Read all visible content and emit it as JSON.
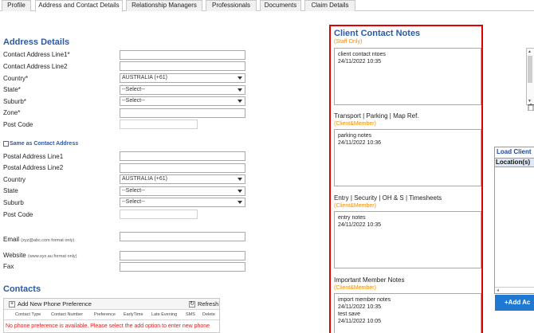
{
  "tabs": [
    {
      "label": "Profile"
    },
    {
      "label": "Address and Contact Details"
    },
    {
      "label": "Relationship Managers"
    },
    {
      "label": "Professionals"
    },
    {
      "label": "Documents"
    },
    {
      "label": "Claim Details"
    }
  ],
  "active_tab": "Address and Contact Details",
  "address": {
    "heading": "Address Details",
    "line1_label": "Contact Address Line1*",
    "line2_label": "Contact Address Line2",
    "country_label": "Country*",
    "country_value": "AUSTRALIA (+61)",
    "state_label": "State*",
    "state_value": "--Select--",
    "suburb_label": "Suburb*",
    "suburb_value": "--Select--",
    "zone_label": "Zone*",
    "postcode_label": "Post Code"
  },
  "postal": {
    "same_as_label": "Same as Contact Address",
    "line1_label": "Postal Address Line1",
    "line2_label": "Postal Address Line2",
    "country_label": "Country",
    "country_value": "AUSTRALIA (+61)",
    "state_label": "State",
    "state_value": "--Select--",
    "suburb_label": "Suburb",
    "suburb_value": "--Select--",
    "postcode_label": "Post Code"
  },
  "contact_fields": {
    "email_label": "Email",
    "email_hint": "(xyz@abc.com format only)",
    "website_label": "Website",
    "website_hint": "(www.xyz.au format only)",
    "fax_label": "Fax"
  },
  "contacts": {
    "heading": "Contacts",
    "add_label": "Add New Phone Preference",
    "refresh_label": "Refresh",
    "columns": [
      "Contact Type",
      "Contact Number",
      "Preference",
      "EarlyTime",
      "Late Evening",
      "SMS",
      "Delete"
    ],
    "empty_message": "No phone preference is available. Please select the add option to enter new phone"
  },
  "notes": {
    "title": "Client Contact Notes",
    "subtitle": "(Staff Only)",
    "staff_note_lines": [
      "client contact ntoes",
      "24/11/2022 10:35"
    ],
    "sections": [
      {
        "category": "Transport | Parking | Map Ref.",
        "audience": "(Client&Member)",
        "lines": [
          "parking notes",
          "24/11/2022 10:36"
        ]
      },
      {
        "category": "Entry | Security | OH & S | Timesheets",
        "audience": "(Client&Member)",
        "lines": [
          "entry notes",
          "24/11/2022 10:35"
        ]
      },
      {
        "category": "Important Member Notes",
        "audience": "(Client&Member)",
        "lines": [
          "import member notes",
          "24/11/2022 10:35",
          "test save",
          "24/11/2022 10:05"
        ]
      }
    ]
  },
  "side_panel": {
    "title": "Load Client",
    "column": "Location(s)",
    "add_button": "+Add Ac"
  },
  "colors": {
    "heading_blue": "#2a5aa8",
    "highlight_red": "#e00000",
    "subtitle_orange": "#f08c00",
    "warning_red": "#e02020",
    "button_blue": "#1f78d1"
  }
}
